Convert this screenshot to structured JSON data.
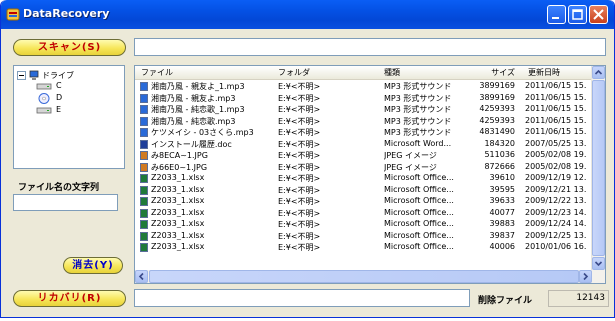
{
  "window": {
    "title": "DataRecovery"
  },
  "buttons": {
    "scan": "スキャン(S)",
    "clear": "消去(Y)",
    "recover": "リカバリ(R)"
  },
  "path_field": {
    "value": ""
  },
  "tree": {
    "root_label": "ドライブ",
    "items": [
      {
        "label": "C",
        "icon": "drive-icon"
      },
      {
        "label": "D",
        "icon": "cd-drive-icon"
      },
      {
        "label": "E",
        "icon": "drive-icon"
      }
    ]
  },
  "filename_filter": {
    "label": "ファイル名の文字列",
    "value": ""
  },
  "file_list": {
    "columns": [
      "ファイル",
      "フォルダ",
      "種類",
      "サイズ",
      "更新日時"
    ],
    "rows": [
      {
        "icon": "audio-file-icon",
        "name": "湘南乃風 - 親友よ_1.mp3",
        "folder": "E:¥<不明>",
        "type": "MP3 形式サウンド",
        "size": "3899169",
        "date": "2011/06/15 15."
      },
      {
        "icon": "audio-file-icon",
        "name": "湘南乃風 - 親友よ.mp3",
        "folder": "E:¥<不明>",
        "type": "MP3 形式サウンド",
        "size": "3899169",
        "date": "2011/06/15 15."
      },
      {
        "icon": "audio-file-icon",
        "name": "湘南乃風 - 純恋歌_1.mp3",
        "folder": "E:¥<不明>",
        "type": "MP3 形式サウンド",
        "size": "4259393",
        "date": "2011/06/15 15."
      },
      {
        "icon": "audio-file-icon",
        "name": "湘南乃風 - 純恋歌.mp3",
        "folder": "E:¥<不明>",
        "type": "MP3 形式サウンド",
        "size": "4259393",
        "date": "2011/06/15 15."
      },
      {
        "icon": "audio-file-icon",
        "name": "ケツメイシ - 03さくら.mp3",
        "folder": "E:¥<不明>",
        "type": "MP3 形式サウンド",
        "size": "4831490",
        "date": "2011/06/15 15."
      },
      {
        "icon": "word-file-icon",
        "name": "インストール履歴.doc",
        "folder": "E:¥<不明>",
        "type": "Microsoft Word...",
        "size": "184320",
        "date": "2007/05/25 13."
      },
      {
        "icon": "image-file-icon",
        "name": "み8ECA~1.JPG",
        "folder": "E:¥<不明>",
        "type": "JPEG イメージ",
        "size": "511036",
        "date": "2005/02/08 19."
      },
      {
        "icon": "image-file-icon",
        "name": "み66E0~1.JPG",
        "folder": "E:¥<不明>",
        "type": "JPEG イメージ",
        "size": "872666",
        "date": "2005/02/08 19."
      },
      {
        "icon": "excel-file-icon",
        "name": "Z2033_1.xlsx",
        "folder": "E:¥<不明>",
        "type": "Microsoft Office...",
        "size": "39610",
        "date": "2009/12/19 12."
      },
      {
        "icon": "excel-file-icon",
        "name": "Z2033_1.xlsx",
        "folder": "E:¥<不明>",
        "type": "Microsoft Office...",
        "size": "39595",
        "date": "2009/12/21 13."
      },
      {
        "icon": "excel-file-icon",
        "name": "Z2033_1.xlsx",
        "folder": "E:¥<不明>",
        "type": "Microsoft Office...",
        "size": "39633",
        "date": "2009/12/22 13."
      },
      {
        "icon": "excel-file-icon",
        "name": "Z2033_1.xlsx",
        "folder": "E:¥<不明>",
        "type": "Microsoft Office...",
        "size": "40077",
        "date": "2009/12/23 14."
      },
      {
        "icon": "excel-file-icon",
        "name": "Z2033_1.xlsx",
        "folder": "E:¥<不明>",
        "type": "Microsoft Office...",
        "size": "39883",
        "date": "2009/12/24 14."
      },
      {
        "icon": "excel-file-icon",
        "name": "Z2033_1.xlsx",
        "folder": "E:¥<不明>",
        "type": "Microsoft Office...",
        "size": "39837",
        "date": "2009/12/25 13."
      },
      {
        "icon": "excel-file-icon",
        "name": "Z2033_1.xlsx",
        "folder": "E:¥<不明>",
        "type": "Microsoft Office...",
        "size": "40006",
        "date": "2010/01/06 16."
      }
    ]
  },
  "status": {
    "recover_path": "",
    "deleted_label": "削除ファイル",
    "deleted_count": "12143"
  },
  "colors": {
    "titlebar": "#0450e3",
    "button_face": "#f6e65a",
    "scan_text": "#c00000",
    "clear_text": "#0000c8"
  }
}
